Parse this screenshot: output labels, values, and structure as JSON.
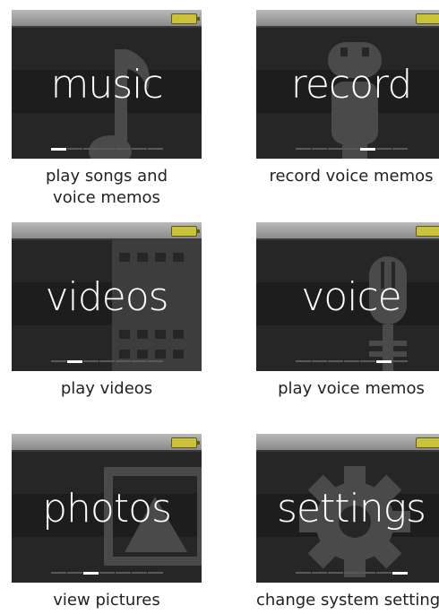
{
  "tiles": [
    {
      "name": "music",
      "screen_label": "music",
      "caption": [
        "play songs and",
        "voice memos"
      ],
      "icon": "music-note-icon",
      "active_page": 1
    },
    {
      "name": "record",
      "screen_label": "record",
      "caption": [
        "record voice memos"
      ],
      "icon": "microphone-icon",
      "active_page": 5
    },
    {
      "name": "videos",
      "screen_label": "videos",
      "caption": [
        "play videos"
      ],
      "icon": "film-strip-icon",
      "active_page": 2
    },
    {
      "name": "voice",
      "screen_label": "voice",
      "caption": [
        "play voice memos"
      ],
      "icon": "microphone-icon",
      "active_page": 6
    },
    {
      "name": "photos",
      "screen_label": "photos",
      "caption": [
        "view pictures"
      ],
      "icon": "picture-frame-icon",
      "active_page": 3
    },
    {
      "name": "settings",
      "screen_label": "settings",
      "caption": [
        "change system settings"
      ],
      "icon": "gear-icon",
      "active_page": 7
    }
  ],
  "pager_total": 7,
  "colors": {
    "screen_bg": "#262626",
    "status_bar": "#a8a8a8",
    "battery": "#c9c23a",
    "label": "#ffffff",
    "caption": "#222222"
  }
}
